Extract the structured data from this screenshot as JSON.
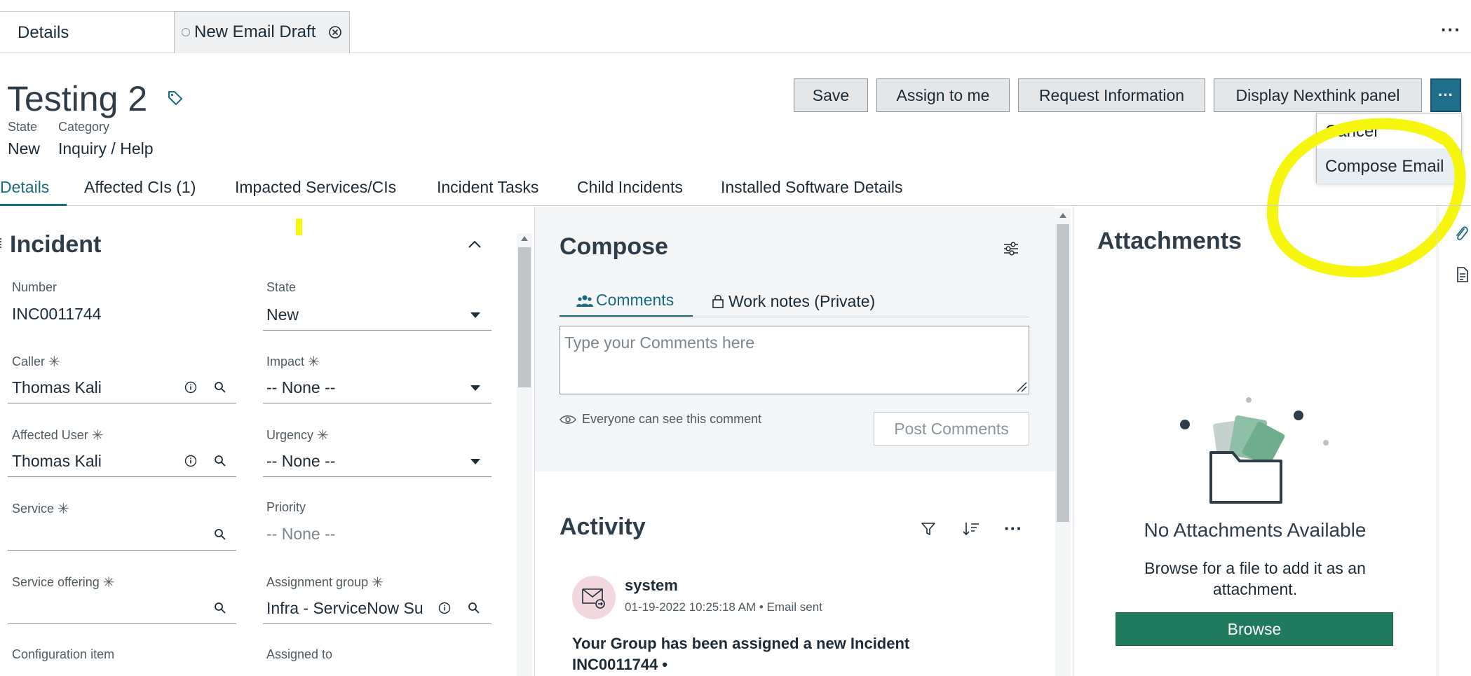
{
  "top_tabs": {
    "details_label": "Details",
    "draft_label": "New Email Draft"
  },
  "record": {
    "title": "Testing 2",
    "state_label": "State",
    "state_value": "New",
    "category_label": "Category",
    "category_value": "Inquiry / Help"
  },
  "header_buttons": {
    "save": "Save",
    "assign": "Assign to me",
    "request": "Request Information",
    "nexthink": "Display Nexthink panel"
  },
  "menu": {
    "items": [
      "Cancel",
      "Compose Email"
    ]
  },
  "section_tabs": [
    "Details",
    "Affected CIs (1)",
    "Impacted Services/CIs",
    "Incident Tasks",
    "Child Incidents",
    "Installed Software Details"
  ],
  "form": {
    "title": "Incident",
    "number_label": "Number",
    "number_value": "INC0011744",
    "state_label": "State",
    "state_value": "New",
    "caller_label": "Caller",
    "caller_value": "Thomas Kali",
    "impact_label": "Impact",
    "impact_value": "-- None --",
    "affected_user_label": "Affected User",
    "affected_user_value": "Thomas Kali",
    "urgency_label": "Urgency",
    "urgency_value": "-- None --",
    "service_label": "Service",
    "priority_label": "Priority",
    "priority_value": "-- None --",
    "service_offering_label": "Service offering",
    "assignment_group_label": "Assignment group",
    "assignment_group_value": "Infra - ServiceNow Su",
    "config_item_label": "Configuration item",
    "assigned_to_label": "Assigned to"
  },
  "compose": {
    "title": "Compose",
    "tab_comments": "Comments",
    "tab_work_notes": "Work notes (Private)",
    "placeholder": "Type your Comments here",
    "visibility_note": "Everyone can see this comment",
    "post_button": "Post Comments"
  },
  "activity": {
    "title": "Activity",
    "user": "system",
    "timestamp": "01-19-2022 10:25:18 AM • Email sent",
    "body": "Your Group has been assigned a new Incident INC0011744 •"
  },
  "attachments": {
    "title": "Attachments",
    "empty_title": "No Attachments Available",
    "help": "Browse for a file to add it as an attachment.",
    "browse_button": "Browse"
  },
  "colors": {
    "accent": "#1a6a82",
    "more_button": "#1f6f8c",
    "browse": "#1f7a5e",
    "highlight": "#f5f50d"
  }
}
